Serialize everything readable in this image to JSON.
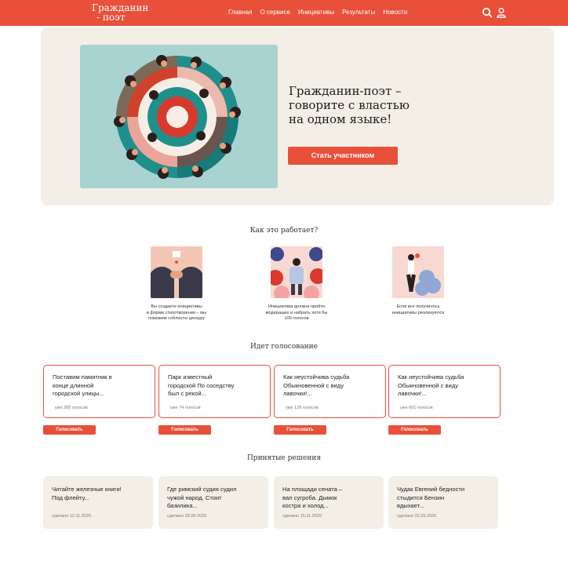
{
  "header": {
    "logo_line1": "Гражданин",
    "logo_line2": "- поэт",
    "nav": [
      "Главная",
      "О сервисе",
      "Инициативы",
      "Результаты",
      "Новости"
    ],
    "icons": [
      "search-icon",
      "user-icon"
    ]
  },
  "hero": {
    "title_line1": "Гражданин-поэт –",
    "title_line2": "говорите с властью",
    "title_line3": "на одном языке!",
    "button": "Стать участником"
  },
  "how": {
    "title": "Как это работает?",
    "steps": [
      {
        "line1": "Вы создаете инициативы",
        "line2": "в форме стихотворения – мы",
        "line3": "поможем соблюсти цензуру"
      },
      {
        "line1": "Инициатива должна пройти",
        "line2": "модерацию и набрать хотя бы",
        "line3": "100 голосов"
      },
      {
        "line1": "Если все получилось",
        "line2": "инициативы реализуются",
        "line3": ""
      }
    ]
  },
  "voting": {
    "title": "Идет голосование",
    "button": "Голосовать",
    "cards": [
      {
        "l1": "Поставим памятник в",
        "l2": "конце длинной",
        "l3": "городской улицы...",
        "count": "уже 285 голосов"
      },
      {
        "l1": "Парк известный",
        "l2": "городской По соседству",
        "l3": "был с рекой...",
        "count": "уже 74 голосов"
      },
      {
        "l1": "Как неустойчива судьба",
        "l2": "Обыкновенной с виду",
        "l3": "лавочки!...",
        "count": "уже 128 голосов"
      },
      {
        "l1": "Как неустойчива судьба",
        "l2": "Обыкновенной с виду",
        "l3": "лавочки!...",
        "count": "уже 601 голосов"
      }
    ]
  },
  "decisions": {
    "title": "Принятые решения",
    "cards": [
      {
        "l1": "Читайте железные книги!",
        "l2": "Под флейту...",
        "l3": "",
        "date": "сделано 12.11.2020"
      },
      {
        "l1": "Где римский судия судил",
        "l2": "чужой народ. Стоит",
        "l3": "базилика...",
        "date": "сделано 03.09.2020"
      },
      {
        "l1": "На площади сената –",
        "l2": "вал сугроба. Дымок",
        "l3": "костра и холод...",
        "date": "сделано 15.11.2020"
      },
      {
        "l1": "Чудак Евгений бедности",
        "l2": "стыдится Бензин",
        "l3": "вдыхает...",
        "date": "сделано 01.09.2020"
      }
    ]
  },
  "colors": {
    "accent": "#e8503a",
    "cream": "#f3efe6",
    "teal": "#a8d3d1"
  }
}
